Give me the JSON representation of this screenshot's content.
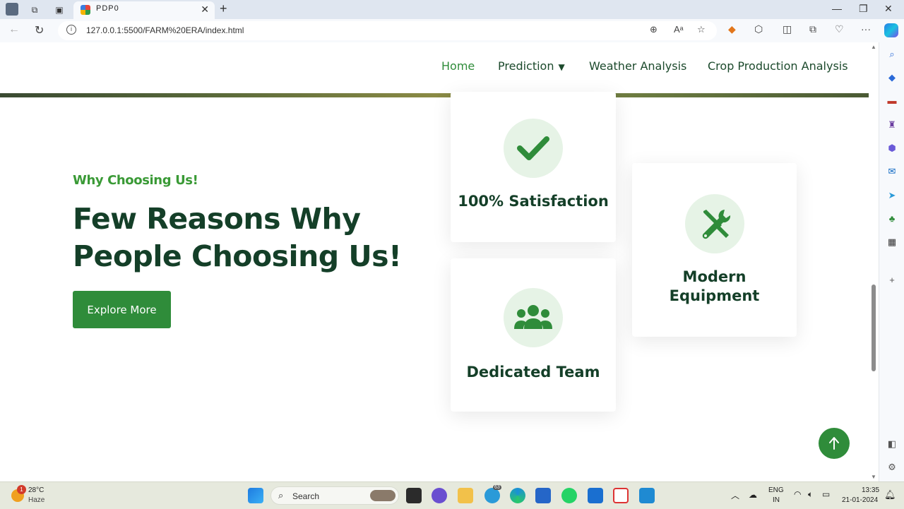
{
  "browser": {
    "tab_title": "PDP0",
    "url": "127.0.0.1:5500/FARM%20ERA/index.html"
  },
  "site": {
    "nav": [
      {
        "label": "Home",
        "active": true
      },
      {
        "label": "Prediction",
        "dropdown": true
      },
      {
        "label": "Weather Analysis"
      },
      {
        "label": "Crop Production Analysis"
      }
    ]
  },
  "hero": {
    "eyebrow": "Why Choosing Us!",
    "headline": "Few Reasons Why People Choosing Us!",
    "button": "Explore More"
  },
  "features": [
    {
      "title": "100% Satisfaction",
      "icon": "check-icon"
    },
    {
      "title": "Dedicated Team",
      "icon": "team-icon"
    },
    {
      "title": "Modern Equipment",
      "icon": "tools-icon"
    }
  ],
  "taskbar": {
    "weather_temp": "28°C",
    "weather_desc": "Haze",
    "weather_badge": "1",
    "search_label": "Search",
    "lang": "ENG",
    "region": "IN",
    "time": "13:35",
    "date": "21-01-2024",
    "telegram_badge": "63"
  },
  "colors": {
    "brand_green": "#2f8c3a",
    "dark_green": "#143f28",
    "light_green": "#e6f3e6"
  }
}
